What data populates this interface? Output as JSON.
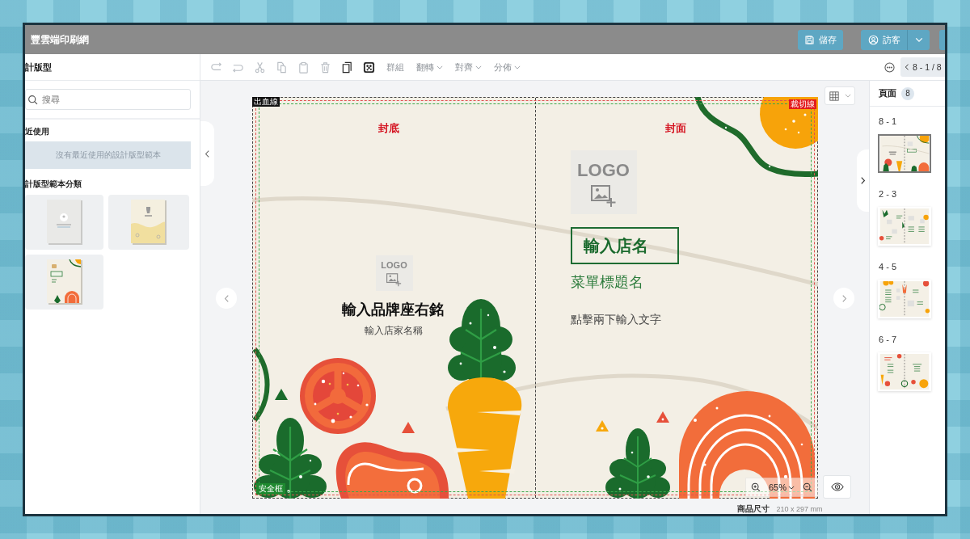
{
  "header": {
    "title": "豐雲端印刷網",
    "save_label": "儲存",
    "user_label": "訪客"
  },
  "left_panel": {
    "title": "計版型",
    "search": {
      "placeholder": "搜尋"
    },
    "recent": {
      "heading": "近使用",
      "empty_text": "沒有最近使用的設計版型範本"
    },
    "categories": {
      "heading": "計版型範本分類",
      "templates": [
        {
          "kind": "upload"
        },
        {
          "kind": "illustrated"
        },
        {
          "kind": "menu"
        }
      ]
    }
  },
  "toolbar": {
    "tools": [
      {
        "kind": "redo",
        "disabled": true
      },
      {
        "kind": "undo",
        "disabled": true
      },
      {
        "kind": "cut",
        "disabled": true
      },
      {
        "kind": "copy",
        "disabled": true
      },
      {
        "kind": "paste",
        "disabled": true
      },
      {
        "kind": "delete",
        "disabled": true
      },
      {
        "kind": "duplicate",
        "disabled": false
      },
      {
        "kind": "pattern",
        "disabled": false
      },
      {
        "kind": "text",
        "label": "群組",
        "disabled": true
      },
      {
        "kind": "dropdown",
        "label": "翻轉",
        "disabled": true
      },
      {
        "kind": "dropdown",
        "label": "對齊",
        "disabled": true
      },
      {
        "kind": "dropdown",
        "label": "分佈",
        "disabled": true
      }
    ],
    "page_indicator": "8 - 1 / 8"
  },
  "canvas": {
    "guides": {
      "bleed_label": "出血線",
      "trim_label": "裁切線",
      "safe_label": "安全框"
    },
    "back_cover": {
      "heading": "封底",
      "logo": "LOGO",
      "motto": "輸入品牌座右銘",
      "store_name": "輸入店家名稱"
    },
    "front_cover": {
      "heading": "封面",
      "logo": "LOGO",
      "shop_name": "輸入店名",
      "menu_title": "菜單標題名",
      "body_text": "點擊兩下輸入文字"
    },
    "zoom": "65%",
    "product_size": {
      "label": "商品尺寸",
      "value": "210 x 297 mm"
    }
  },
  "pages_panel": {
    "title": "頁面",
    "count": "8",
    "pages": [
      {
        "label": "8 - 1",
        "selected": true
      },
      {
        "label": "2 - 3",
        "selected": false
      },
      {
        "label": "4 - 5",
        "selected": false
      },
      {
        "label": "6 - 7",
        "selected": false
      }
    ]
  }
}
